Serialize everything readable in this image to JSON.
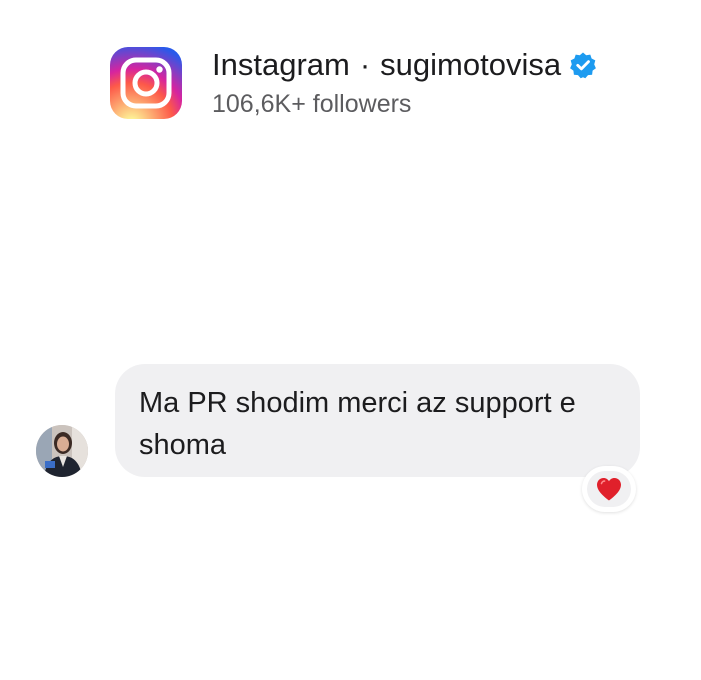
{
  "header": {
    "platform": "Instagram",
    "separator": "·",
    "username": "sugimotovisa",
    "followers": "106,6K+ followers",
    "logo_icon": "instagram-logo-icon",
    "verified_icon": "verified-badge-icon"
  },
  "message": {
    "text": "Ma PR shodim merci az support e shoma",
    "avatar_icon": "user-avatar",
    "reaction": {
      "icon": "red-heart-icon",
      "color": "#e0202b"
    }
  },
  "colors": {
    "bubble": "#f0f0f2",
    "verified": "#1d9bf0",
    "followers_text": "#5c5c5f"
  }
}
